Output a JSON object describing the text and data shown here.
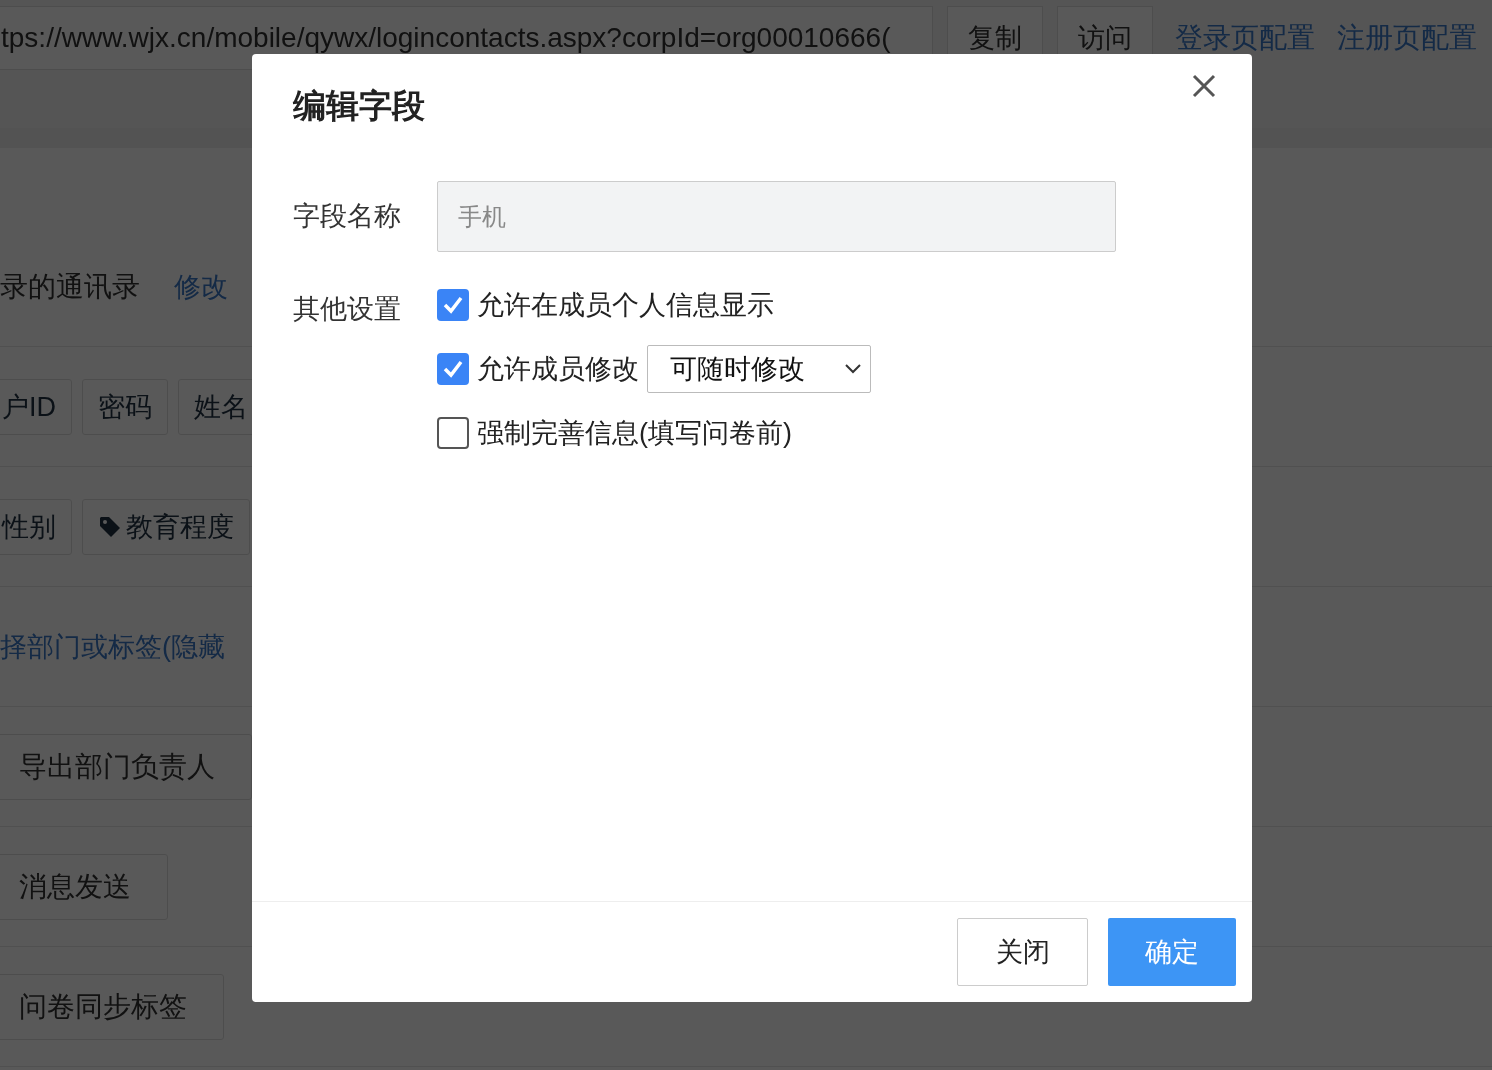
{
  "background": {
    "address_bar": {
      "value": "tps://www.wjx.cn/mobile/qywx/logincontacts.aspx?corpId=org00010666("
    },
    "buttons": [
      "复制",
      "访问"
    ],
    "links": [
      "登录页配置",
      "注册页配置"
    ],
    "rows": [
      {
        "kind": "text_link",
        "text": "录的通讯录",
        "link": "修改"
      },
      {
        "kind": "tags",
        "tags": [
          {
            "label": "户ID",
            "icon": false
          },
          {
            "label": "密码",
            "icon": false
          },
          {
            "label": "姓名",
            "icon": false
          }
        ]
      },
      {
        "kind": "tags",
        "tags": [
          {
            "label": "性别",
            "icon": false
          },
          {
            "label": "教育程度",
            "icon": true
          }
        ]
      },
      {
        "kind": "link",
        "text": "择部门或标签(隐藏"
      },
      {
        "kind": "button",
        "text": "导出部门负责人"
      },
      {
        "kind": "button",
        "text": "消息发送"
      },
      {
        "kind": "button",
        "text": "问卷同步标签"
      }
    ]
  },
  "dialog": {
    "title": "编辑字段",
    "name_label": "字段名称",
    "name_field": {
      "value": "手机",
      "disabled": true
    },
    "other_label": "其他设置",
    "options": [
      {
        "kind": "checkbox",
        "label": "允许在成员个人信息显示",
        "checked": true
      },
      {
        "kind": "checkbox_select",
        "label": "允许成员修改",
        "checked": true,
        "select_value": "可随时修改"
      },
      {
        "kind": "checkbox",
        "label": "强制完善信息(填写问卷前)",
        "checked": false
      }
    ],
    "buttons": [
      {
        "label": "关闭",
        "primary": false
      },
      {
        "label": "确定",
        "primary": true
      }
    ]
  }
}
